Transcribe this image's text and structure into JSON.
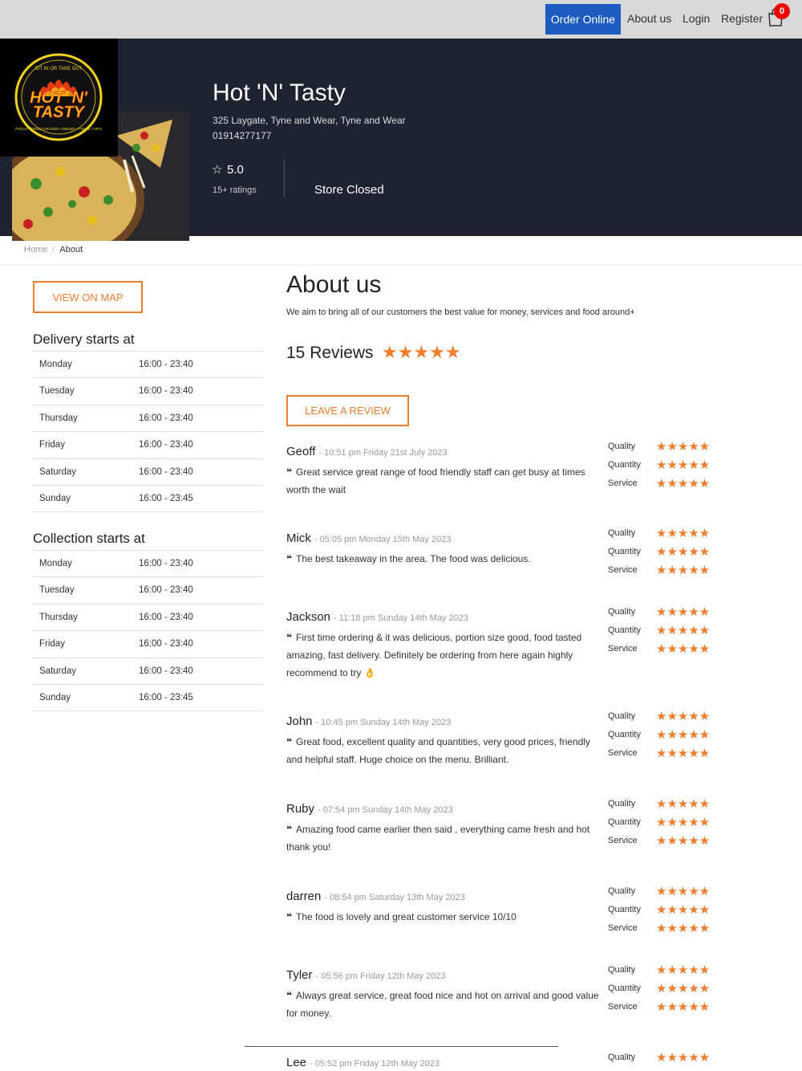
{
  "nav": {
    "order_online": "Order Online",
    "about_us": "About us",
    "login": "Login",
    "register": "Register",
    "cart_count": "0"
  },
  "store": {
    "name": "Hot 'N' Tasty",
    "address": "325 Laygate, Tyne and Wear, Tyne and Wear",
    "phone": "01914277177",
    "rating": "5.0",
    "ratings_count": "15+ ratings",
    "status": "Store Closed"
  },
  "logo": {
    "text_top": "SIT IN OR TAKE OUT",
    "text_main1": "HOT 'N'",
    "text_main2": "TASTY",
    "text_bottom": "PIZZAS • FRIED CHICKEN • KEBABS • FISH & CHIPS"
  },
  "breadcrumb": {
    "home": "Home",
    "separator": "/",
    "current": "About"
  },
  "left": {
    "map_button": "VIEW ON MAP",
    "delivery_title": "Delivery starts at",
    "delivery": [
      {
        "day": "Monday",
        "time": "16:00 - 23:40"
      },
      {
        "day": "Tuesday",
        "time": "16:00 - 23:40"
      },
      {
        "day": "Thursday",
        "time": "16:00 - 23:40"
      },
      {
        "day": "Friday",
        "time": "16:00 - 23:40"
      },
      {
        "day": "Saturday",
        "time": "16:00 - 23:40"
      },
      {
        "day": "Sunday",
        "time": "16:00 - 23:45"
      }
    ],
    "collection_title": "Collection starts at",
    "collection": [
      {
        "day": "Monday",
        "time": "16:00 - 23:40"
      },
      {
        "day": "Tuesday",
        "time": "16:00 - 23:40"
      },
      {
        "day": "Thursday",
        "time": "16:00 - 23:40"
      },
      {
        "day": "Friday",
        "time": "16:00 - 23:40"
      },
      {
        "day": "Saturday",
        "time": "16:00 - 23:40"
      },
      {
        "day": "Sunday",
        "time": "16:00 - 23:45"
      }
    ]
  },
  "about": {
    "title": "About us",
    "text": "We aim to bring all of our customers the best value for money, services and food around+",
    "reviews_count": "15 Reviews",
    "overall_stars": "★★★★★",
    "leave_review": "LEAVE A REVIEW"
  },
  "rate_labels": {
    "quality": "Quality",
    "quantity": "Quantity",
    "service": "Service"
  },
  "stars": "★★★★★",
  "reviews": [
    {
      "name": "Geoff",
      "date": "- 10:51 pm Friday 21st July 2023",
      "text": "Great service great range of food friendly staff can get busy at times worth the wait"
    },
    {
      "name": "Mick",
      "date": "- 05:05 pm Monday 15th May 2023",
      "text": "The best takeaway in the area. The food was delicious."
    },
    {
      "name": "Jackson",
      "date": "- 11:18 pm Sunday 14th May 2023",
      "text": "First time ordering & it was delicious, portion size good, food tasted amazing, fast delivery. Definitely be ordering from here again highly recommend to try 👌"
    },
    {
      "name": "John",
      "date": "- 10:45 pm Sunday 14th May 2023",
      "text": "Great food, excellent quality and quantities, very good prices, friendly and helpful staff. Huge choice on the menu. Brilliant."
    },
    {
      "name": "Ruby",
      "date": "- 07:54 pm Sunday 14th May 2023",
      "text": "Amazing food came earlier then said , everything came fresh and hot thank you!"
    },
    {
      "name": "darren",
      "date": "- 08:54 pm Saturday 13th May 2023",
      "text": "The food is lovely and great customer service 10/10"
    },
    {
      "name": "Tyler",
      "date": "- 05:56 pm Friday 12th May 2023",
      "text": "Always great service, great food nice and hot on arrival and good value for money."
    },
    {
      "name": "Lee",
      "date": "- 05:52 pm Friday 12th May 2023",
      "text": ""
    }
  ]
}
